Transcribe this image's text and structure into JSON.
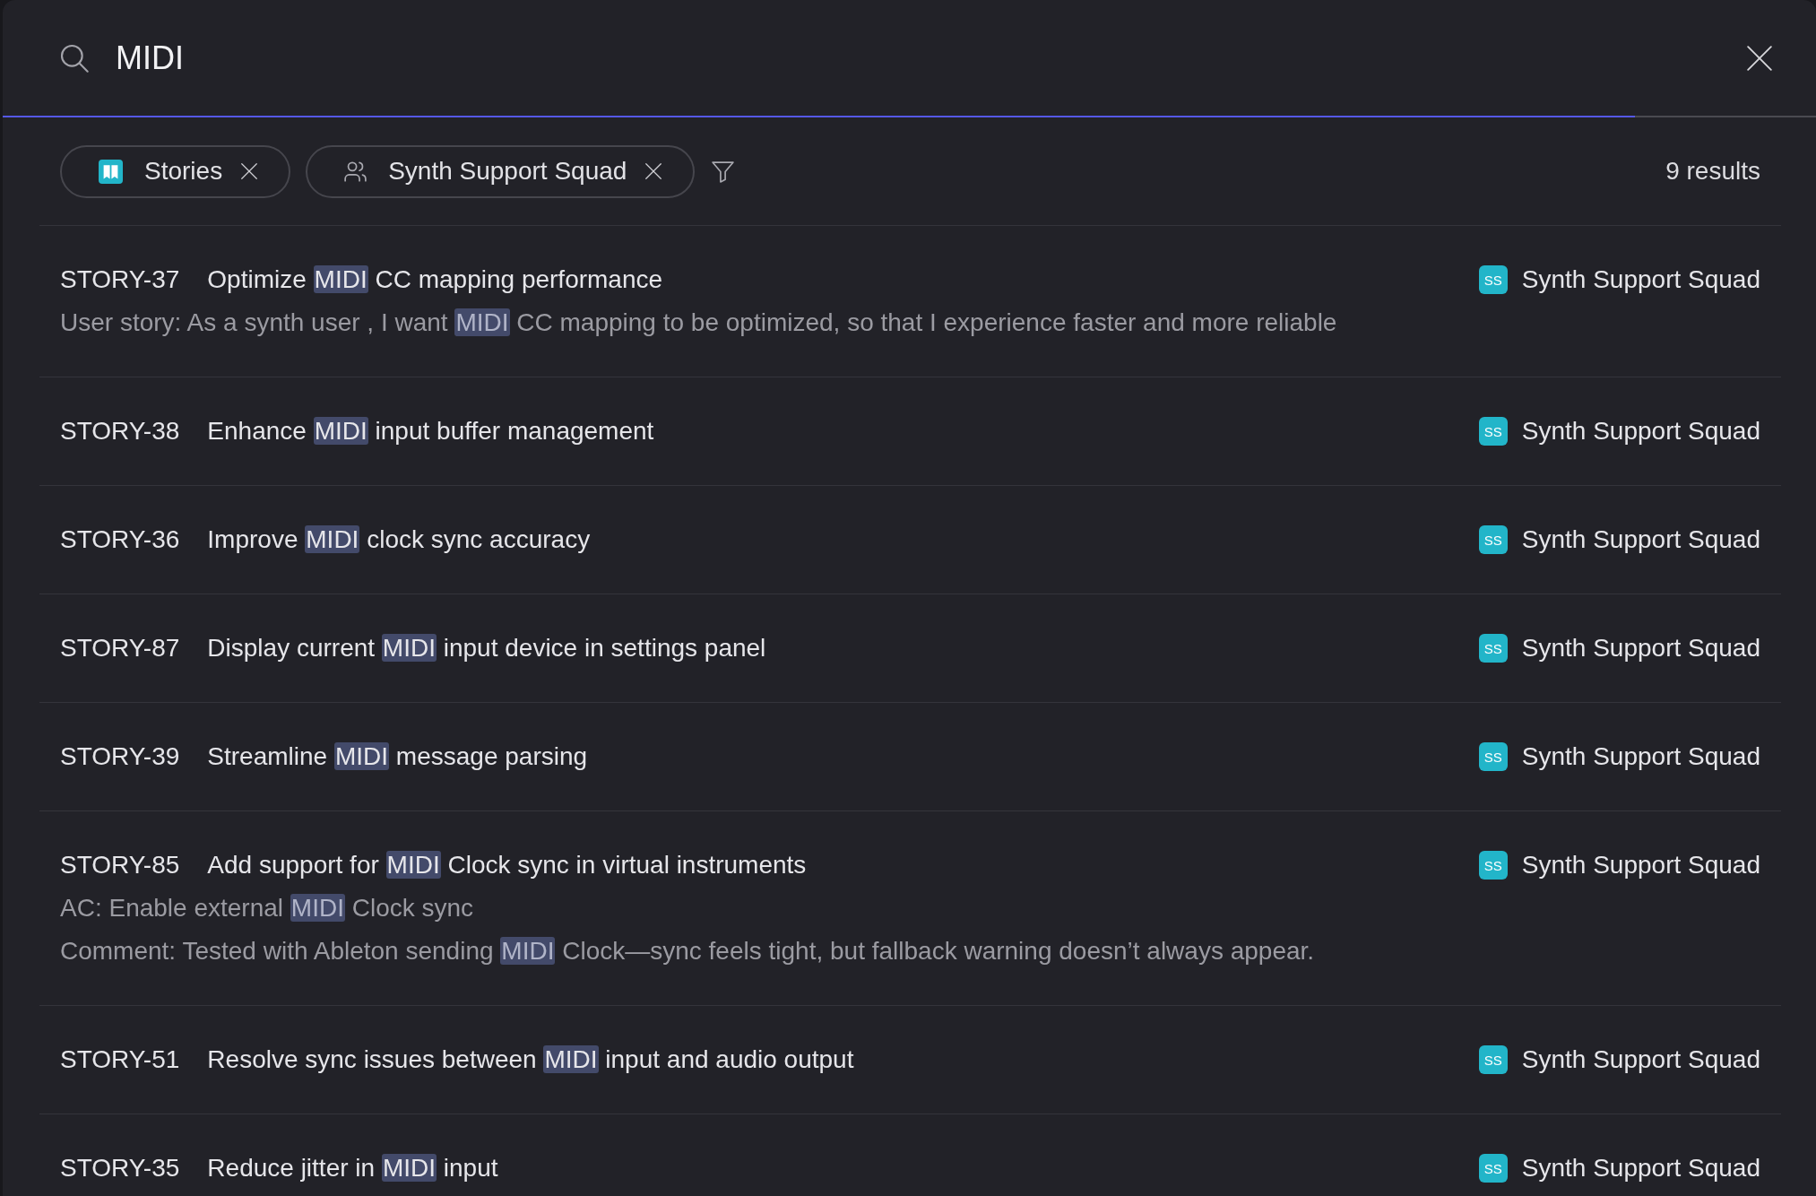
{
  "search": {
    "query": "MIDI",
    "progress": {
      "level": 0.9
    }
  },
  "filters": [
    {
      "kind": "type",
      "label": "Stories"
    },
    {
      "kind": "team",
      "label": "Synth Support Squad"
    }
  ],
  "result_count": "9 results",
  "results": [
    {
      "id": "STORY-37",
      "title": [
        {
          "text": "Optimize ",
          "highlighted": false
        },
        {
          "text": "MIDI",
          "highlighted": true
        },
        {
          "text": " CC mapping performance",
          "highlighted": false
        }
      ],
      "excerpts": [
        [
          {
            "text": "User story: As a synth user , I want ",
            "highlighted": false
          },
          {
            "text": "MIDI",
            "highlighted": true
          },
          {
            "text": " CC mapping to be optimized, so that I experience faster and more reliable",
            "highlighted": false
          }
        ]
      ],
      "team": {
        "initials": "SS",
        "name": "Synth Support Squad"
      }
    },
    {
      "id": "STORY-38",
      "title": [
        {
          "text": "Enhance ",
          "highlighted": false
        },
        {
          "text": "MIDI",
          "highlighted": true
        },
        {
          "text": " input buffer management",
          "highlighted": false
        }
      ],
      "team": {
        "initials": "SS",
        "name": "Synth Support Squad"
      }
    },
    {
      "id": "STORY-36",
      "title": [
        {
          "text": "Improve ",
          "highlighted": false
        },
        {
          "text": "MIDI",
          "highlighted": true
        },
        {
          "text": " clock sync accuracy",
          "highlighted": false
        }
      ],
      "team": {
        "initials": "SS",
        "name": "Synth Support Squad"
      }
    },
    {
      "id": "STORY-87",
      "title": [
        {
          "text": "Display current ",
          "highlighted": false
        },
        {
          "text": "MIDI",
          "highlighted": true
        },
        {
          "text": " input device in settings panel",
          "highlighted": false
        }
      ],
      "team": {
        "initials": "SS",
        "name": "Synth Support Squad"
      }
    },
    {
      "id": "STORY-39",
      "title": [
        {
          "text": "Streamline ",
          "highlighted": false
        },
        {
          "text": "MIDI",
          "highlighted": true
        },
        {
          "text": " message parsing",
          "highlighted": false
        }
      ],
      "team": {
        "initials": "SS",
        "name": "Synth Support Squad"
      }
    },
    {
      "id": "STORY-85",
      "title": [
        {
          "text": "Add support for ",
          "highlighted": false
        },
        {
          "text": "MIDI",
          "highlighted": true
        },
        {
          "text": " Clock sync in virtual instruments",
          "highlighted": false
        }
      ],
      "excerpts": [
        [
          {
            "text": "AC: Enable external ",
            "highlighted": false
          },
          {
            "text": "MIDI",
            "highlighted": true
          },
          {
            "text": " Clock sync",
            "highlighted": false
          }
        ],
        [
          {
            "text": "Comment: Tested with Ableton sending ",
            "highlighted": false
          },
          {
            "text": "MIDI",
            "highlighted": true
          },
          {
            "text": " Clock—sync feels tight, but fallback warning doesn’t always appear.",
            "highlighted": false
          }
        ]
      ],
      "team": {
        "initials": "SS",
        "name": "Synth Support Squad"
      }
    },
    {
      "id": "STORY-51",
      "title": [
        {
          "text": "Resolve sync issues between ",
          "highlighted": false
        },
        {
          "text": "MIDI",
          "highlighted": true
        },
        {
          "text": " input and audio output",
          "highlighted": false
        }
      ],
      "team": {
        "initials": "SS",
        "name": "Synth Support Squad"
      }
    },
    {
      "id": "STORY-35",
      "title": [
        {
          "text": "Reduce jitter in ",
          "highlighted": false
        },
        {
          "text": "MIDI",
          "highlighted": true
        },
        {
          "text": " input",
          "highlighted": false
        }
      ],
      "team": {
        "initials": "SS",
        "name": "Synth Support Squad"
      }
    }
  ]
}
